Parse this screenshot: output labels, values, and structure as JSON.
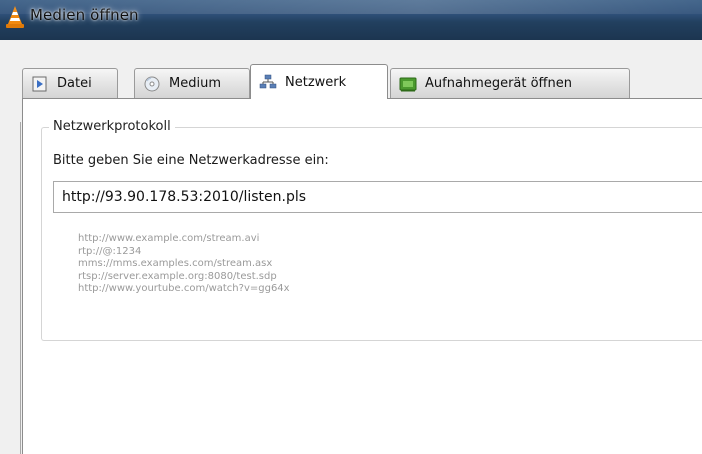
{
  "window": {
    "title": "Medien öffnen",
    "icon": "vlc-cone-icon"
  },
  "tabs": [
    {
      "label": "Datei",
      "icon": "file-icon",
      "active": false
    },
    {
      "label": "Medium",
      "icon": "disc-icon",
      "active": false
    },
    {
      "label": "Netzwerk",
      "icon": "network-icon",
      "active": true
    },
    {
      "label": "Aufnahmegerät öffnen",
      "icon": "capture-device-icon",
      "active": false
    }
  ],
  "network": {
    "group_title": "Netzwerkprotokoll",
    "prompt": "Bitte geben Sie eine Netzwerkadresse ein:",
    "url_value": "http://93.90.178.53:2010/listen.pls",
    "examples": [
      "http://www.example.com/stream.avi",
      "rtp://@:1234",
      "mms://mms.examples.com/stream.asx",
      "rtsp://server.example.org:8080/test.sdp",
      "http://www.yourtube.com/watch?v=gg64x"
    ]
  },
  "colors": {
    "titlebar": "#2f5079",
    "panel_bg": "#ffffff",
    "window_bg": "#f0f0f0",
    "example_text": "#9a9a9a"
  }
}
